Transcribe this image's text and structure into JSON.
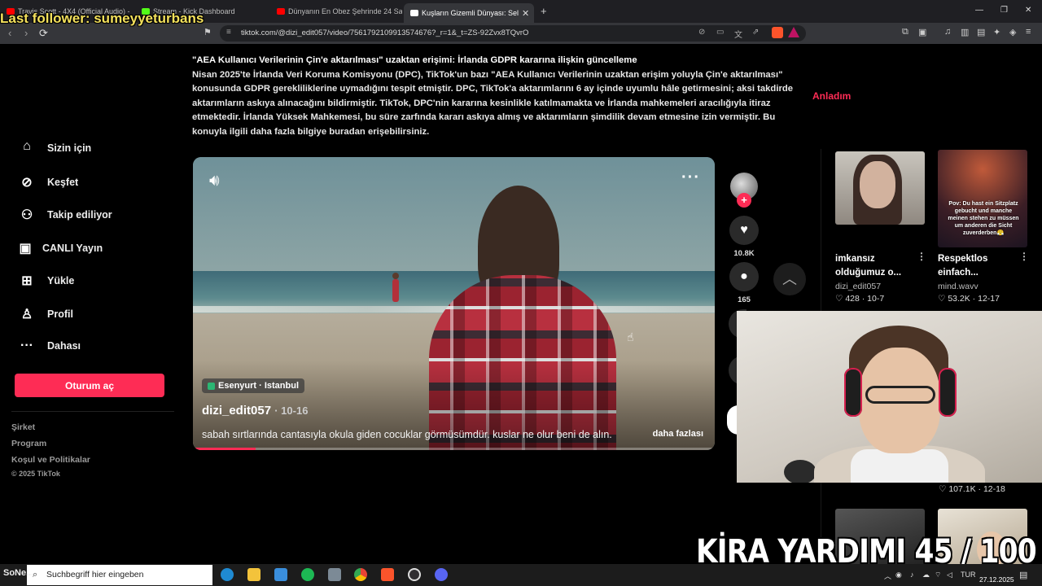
{
  "overlay": {
    "last_follower": "Last follower: sumeyyeturbans",
    "goal_text": "KİRA YARDIMI  45 / 100"
  },
  "browser": {
    "tabs": [
      {
        "label": "Travis Scott - 4X4 (Official Audio) - Yo",
        "favicon_color": "#ff0000"
      },
      {
        "label": "Stream - Kick Dashboard",
        "favicon_color": "#53fc18"
      },
      {
        "label": "Dünyanın En Obez Şehrinde 24 Saat",
        "favicon_color": "#ff0000"
      },
      {
        "label": "Kuşların Gizemli Dünyası: Sel",
        "favicon_color": "#ffffff",
        "close": "✕"
      }
    ],
    "new_tab": "+",
    "url": "tiktok.com/@dizi_edit057/video/7561792109913574676?_r=1&_t=ZS-92Zvx8TQvrO"
  },
  "sidebar": {
    "items": [
      {
        "label": "Sizin için",
        "icon": "home-icon"
      },
      {
        "label": "Keşfet",
        "icon": "compass-icon"
      },
      {
        "label": "Takip ediliyor",
        "icon": "following-icon"
      },
      {
        "label": "CANLI Yayın",
        "icon": "live-icon"
      },
      {
        "label": "Yükle",
        "icon": "upload-icon"
      },
      {
        "label": "Profil",
        "icon": "profile-icon"
      },
      {
        "label": "Dahası",
        "icon": "more-icon"
      }
    ],
    "login_button": "Oturum aç",
    "footer": [
      "Şirket",
      "Program",
      "Koşul ve Politikalar"
    ],
    "copyright": "© 2025 TikTok"
  },
  "notice": {
    "title": "\"AEA Kullanıcı Verilerinin Çin'e aktarılması\" uzaktan erişimi: İrlanda GDPR kararına ilişkin güncelleme",
    "body": "Nisan 2025'te İrlanda Veri Koruma Komisyonu (DPC), TikTok'un bazı \"AEA Kullanıcı Verilerinin uzaktan erişim yoluyla Çin'e aktarılması\" konusunda GDPR gerekliliklerine uymadığını tespit etmiştir. DPC, TikTok'a aktarımlarını 6 ay içinde uyumlu hâle getirmesini; aksi takdirde aktarımların askıya alınacağını bildirmiştir. TikTok, DPC'nin kararına kesinlikle katılmamakta ve İrlanda mahkemeleri aracılığıyla itiraz etmektedir. İrlanda Yüksek Mahkemesi, bu süre zarfında kararı askıya almış ve aktarımların şimdilik devam etmesine izin vermiştir. Bu konuyla ilgili daha fazla bilgiye buradan erişebilirsiniz.",
    "dismiss": "Anladım"
  },
  "video": {
    "location": "Esenyurt · Istanbul",
    "author": "dizi_edit057",
    "date": "10-16",
    "caption": "sabah sırtlarında cantasıyla okula giden cocuklar görmüsümdür. kuslar ne olur beni de alın.",
    "more": "daha fazlası",
    "progress": 0.12,
    "likes": "10.8K",
    "comments": "165"
  },
  "recommendations": [
    {
      "title": "imkansız olduğumuz o...",
      "user": "dizi_edit057",
      "stats": "♡ 428 · 10-7"
    },
    {
      "title": "Respektlos einfach...",
      "user": "mind.wavv",
      "stats": "♡ 53.2K · 12-17",
      "thumb_text": "Pov: Du hast ein Sitzplatz gebucht und manche meinen stehen zu müssen um anderen die Sicht zuverderben😤"
    }
  ],
  "hidden_rec_stats": "♡ 107.1K · 12-18",
  "taskbar": {
    "search_placeholder": "Suchbegriff hier eingeben",
    "start_label": "SoNe...",
    "language": "TUR",
    "date": "27.12.2025"
  }
}
